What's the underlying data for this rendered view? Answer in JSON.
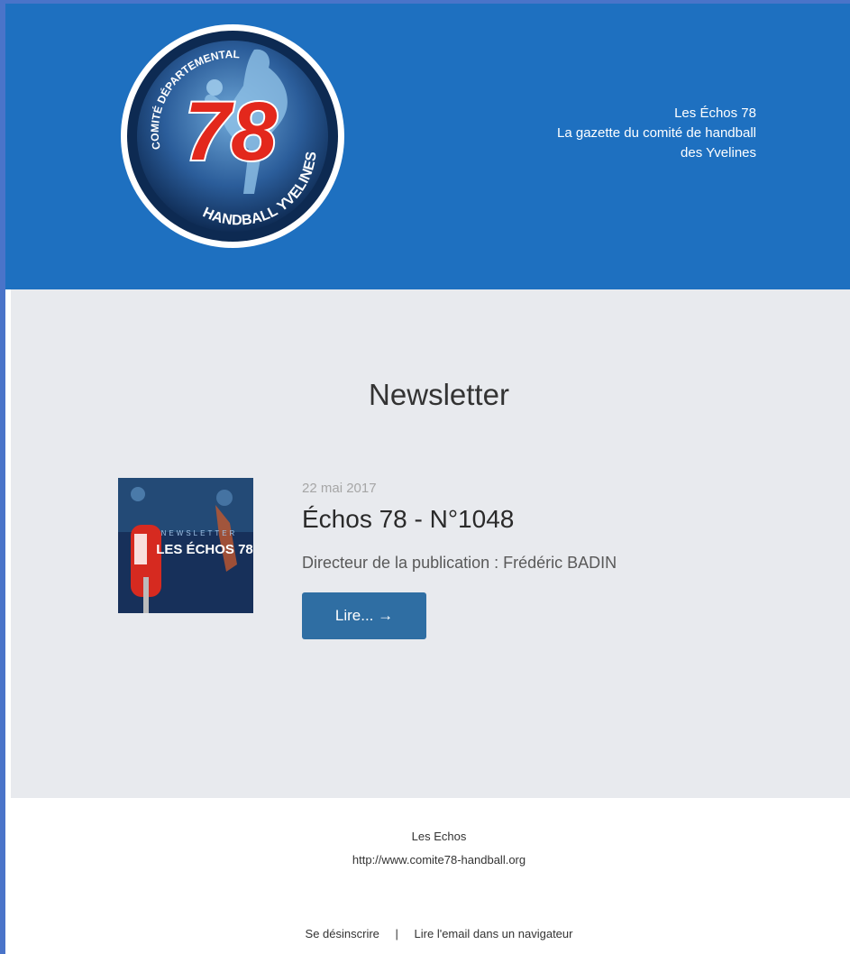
{
  "header": {
    "logo": {
      "top_text": "COMITÉ DÉPARTEMENTAL",
      "number": "78",
      "bottom_text": "HANDBALL YVELINES"
    },
    "title_lines": [
      "Les Échos 78",
      "La gazette du comité de handball",
      "des Yvelines"
    ]
  },
  "main": {
    "title": "Newsletter",
    "article": {
      "thumbnail": {
        "small_text": "NEWSLETTER",
        "big_text": "LES ÉCHOS 78"
      },
      "date": "22 mai 2017",
      "title": "Échos 78 - N°1048",
      "description": "Directeur de la publication : Frédéric BADIN",
      "button_label": "Lire... →"
    }
  },
  "footer": {
    "name": "Les Echos",
    "url": "http://www.comite78-handball.org",
    "links": {
      "unsubscribe": "Se désinscrire",
      "separator": "|",
      "browser": "Lire l'email dans un navigateur"
    }
  },
  "colors": {
    "header_bg": "#1e70c0",
    "main_bg": "#e8eaee",
    "button_bg": "#2f6ea3",
    "logo_red": "#e3281c"
  }
}
